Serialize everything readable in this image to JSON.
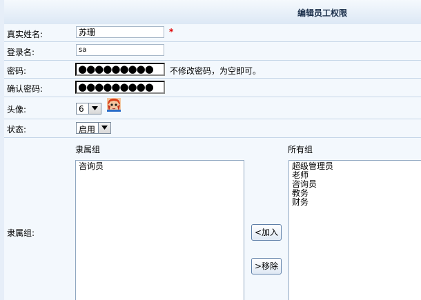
{
  "page": {
    "title": "编辑员工权限"
  },
  "form": {
    "real_name": {
      "label": "真实姓名:",
      "value": "苏珊",
      "required_mark": "*"
    },
    "login_name": {
      "label": "登录名:",
      "value": "sa"
    },
    "password": {
      "label": "密码:",
      "masked": "●●●●●●●●●",
      "hint": "不修改密码，为空即可。"
    },
    "confirm_password": {
      "label": "确认密码:",
      "masked": "●●●●●●●●●"
    },
    "avatar": {
      "label": "头像:",
      "selected": "6"
    },
    "status": {
      "label": "状态:",
      "selected": "启用"
    },
    "groups": {
      "label": "隶属组:",
      "assigned_heading": "隶属组",
      "all_heading": "所有组",
      "assigned": [
        "咨询员"
      ],
      "all": [
        "超级管理员",
        "老师",
        "咨询员",
        "教务",
        "财务"
      ],
      "add_button": "<加入",
      "remove_button": ">移除"
    }
  },
  "icons": {
    "avatar": "cartoon-avatar-icon",
    "dropdown": "dropdown-arrow-icon"
  },
  "colors": {
    "required": "#e00000",
    "row_bg": "#f3f8fd",
    "header_bg": "#dce8f5",
    "border": "#c5d6e8"
  }
}
